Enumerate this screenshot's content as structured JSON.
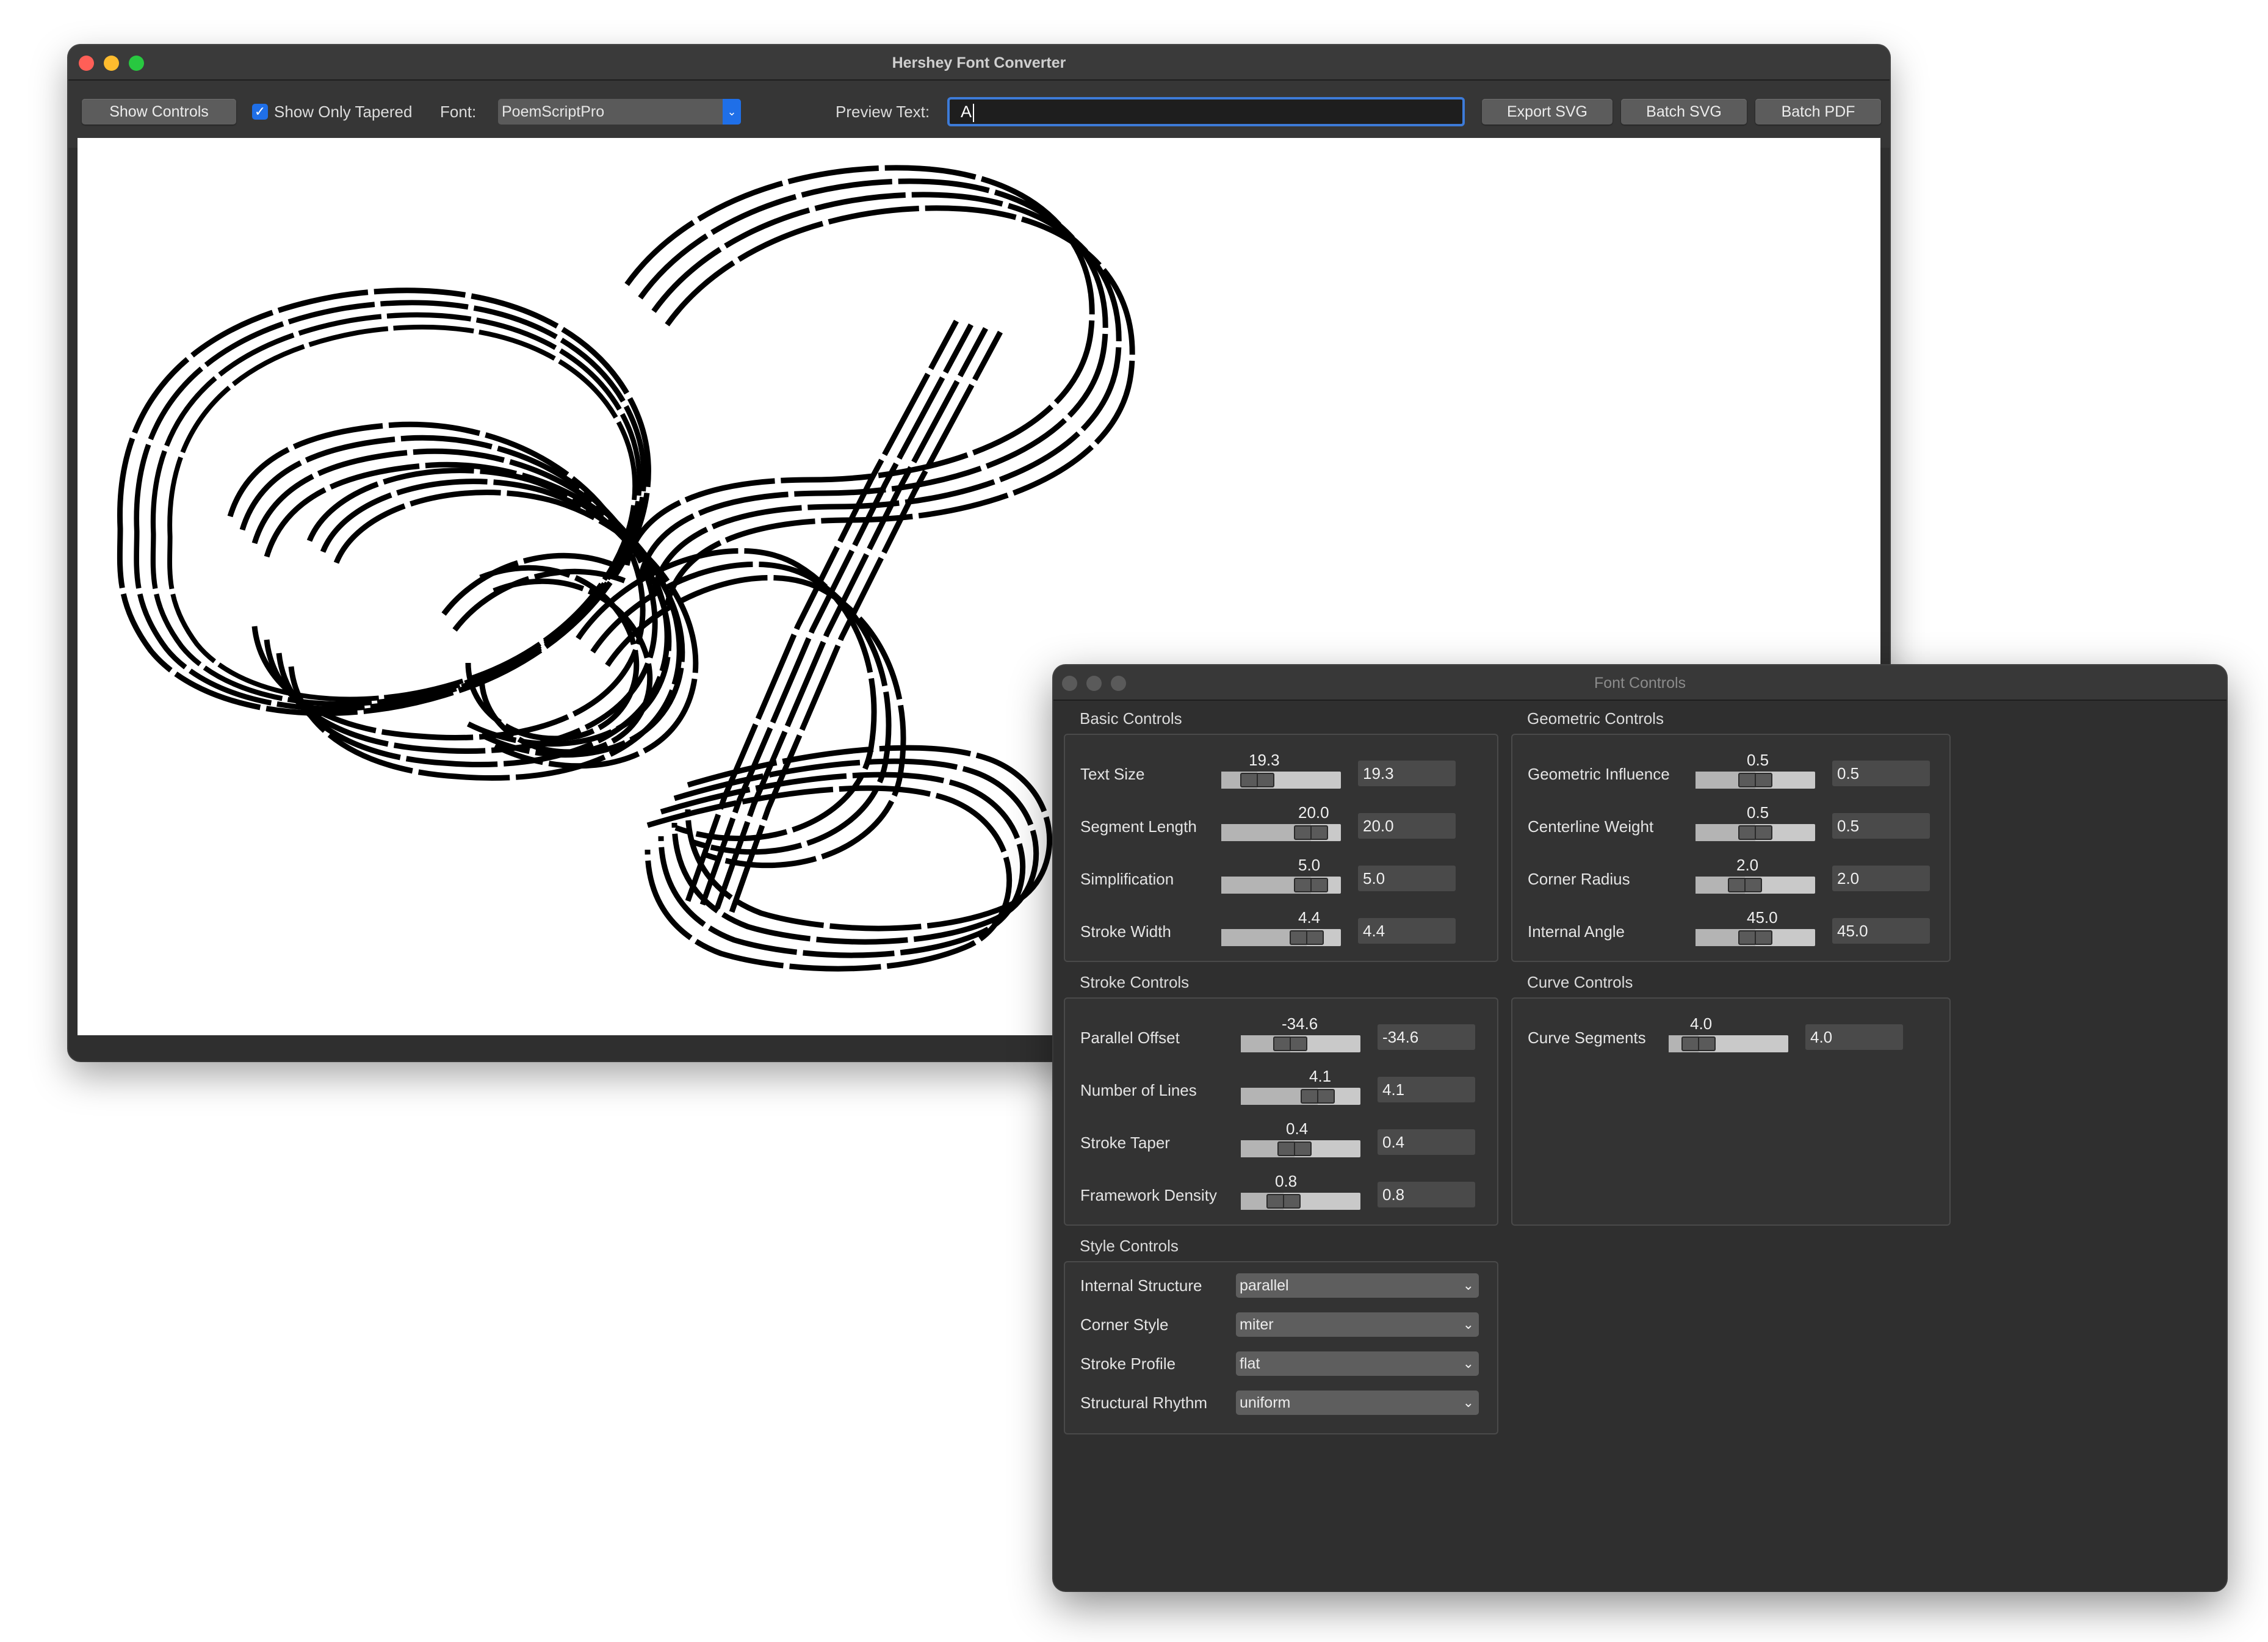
{
  "main_window": {
    "title": "Hershey Font Converter",
    "toolbar": {
      "show_controls": "Show Controls",
      "show_only_tapered": "Show Only Tapered",
      "font_label": "Font:",
      "font_value": "PoemScriptPro",
      "preview_label": "Preview Text:",
      "preview_value": "A",
      "export_svg": "Export SVG",
      "batch_svg": "Batch SVG",
      "batch_pdf": "Batch PDF"
    }
  },
  "controls_window": {
    "title": "Font Controls",
    "basic": {
      "title": "Basic Controls",
      "rows": [
        {
          "label": "Text Size",
          "value": "19.3",
          "level": 0.22
        },
        {
          "label": "Segment Length",
          "value": "20.0",
          "level": 0.85
        },
        {
          "label": "Simplification",
          "value": "5.0",
          "level": 0.85
        },
        {
          "label": "Stroke Width",
          "value": "4.4",
          "level": 0.8
        }
      ]
    },
    "geometric": {
      "title": "Geometric Controls",
      "rows": [
        {
          "label": "Geometric Influence",
          "value": "0.5",
          "level": 0.5
        },
        {
          "label": "Centerline Weight",
          "value": "0.5",
          "level": 0.5
        },
        {
          "label": "Corner Radius",
          "value": "2.0",
          "level": 0.38
        },
        {
          "label": "Internal Angle",
          "value": "45.0",
          "level": 0.5
        }
      ]
    },
    "stroke": {
      "title": "Stroke Controls",
      "rows": [
        {
          "label": "Parallel Offset",
          "value": "-34.6",
          "level": 0.38
        },
        {
          "label": "Number of Lines",
          "value": "4.1",
          "level": 0.7
        },
        {
          "label": "Stroke Taper",
          "value": "0.4",
          "level": 0.43
        },
        {
          "label": "Framework Density",
          "value": "0.8",
          "level": 0.3
        }
      ]
    },
    "curve": {
      "title": "Curve Controls",
      "rows": [
        {
          "label": "Curve Segments",
          "value": "4.0",
          "level": 0.15
        }
      ]
    },
    "style": {
      "title": "Style Controls",
      "rows": [
        {
          "label": "Internal Structure",
          "value": "parallel"
        },
        {
          "label": "Corner Style",
          "value": "miter"
        },
        {
          "label": "Stroke Profile",
          "value": "flat"
        },
        {
          "label": "Structural Rhythm",
          "value": "uniform"
        }
      ]
    }
  },
  "colors": {
    "accent": "#1f6fe8",
    "window_bg": "#2f2f2f",
    "close": "#ff5f57",
    "minimize": "#febc2e",
    "maximize": "#28c840"
  }
}
